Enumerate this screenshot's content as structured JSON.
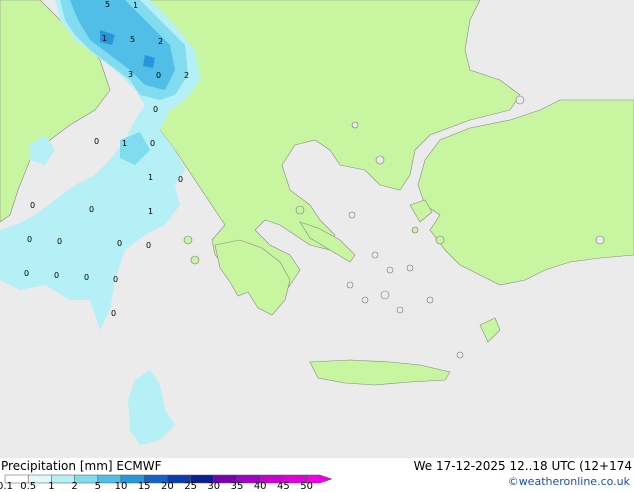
{
  "legend": {
    "title": "Precipitation [mm]",
    "model": "ECMWF",
    "bins": [
      {
        "label": "0.1",
        "color": "#ffffff"
      },
      {
        "label": "0.5",
        "color": "#e0fafa"
      },
      {
        "label": "1",
        "color": "#b4f0f5"
      },
      {
        "label": "2",
        "color": "#82dcf0"
      },
      {
        "label": "5",
        "color": "#50bee6"
      },
      {
        "label": "10",
        "color": "#2896dc"
      },
      {
        "label": "15",
        "color": "#1464c8"
      },
      {
        "label": "20",
        "color": "#0a3cb4"
      },
      {
        "label": "25",
        "color": "#0a1e96"
      },
      {
        "label": "30",
        "color": "#7800b4"
      },
      {
        "label": "35",
        "color": "#a000c8"
      },
      {
        "label": "40",
        "color": "#c800d2"
      },
      {
        "label": "45",
        "color": "#e100dc"
      },
      {
        "label": "50",
        "color": "#f000e6"
      }
    ]
  },
  "valid_time": "We 17-12-2025 12..18 UTC (12+174",
  "credit": "©weatheronline.co.uk",
  "map_labels": [
    "5",
    "1",
    "1",
    "5",
    "2",
    "3",
    "0",
    "2",
    "0",
    "0",
    "1",
    "0",
    "1",
    "0",
    "0",
    "0",
    "1",
    "0",
    "0",
    "0",
    "0",
    "0",
    "0",
    "0",
    "0",
    "0"
  ],
  "colors": {
    "land": "#c8f5a0",
    "sea": "#ebebeb",
    "precip_light": "#b4f0f5",
    "precip_mid": "#82dcf0",
    "precip_heavy": "#50bee6"
  }
}
